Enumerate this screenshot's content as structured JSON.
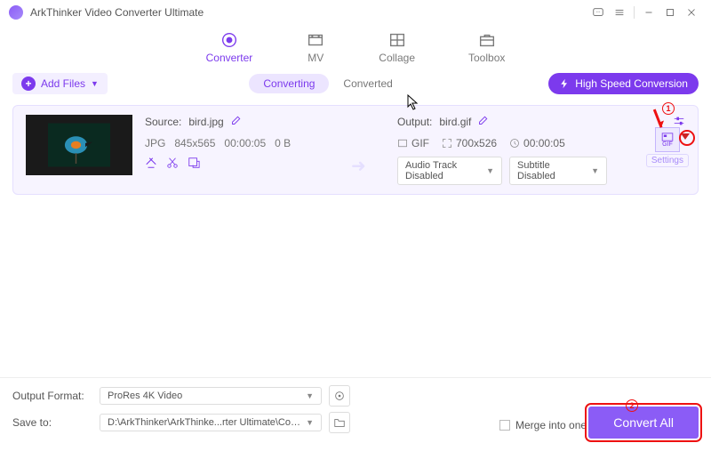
{
  "app": {
    "title": "ArkThinker Video Converter Ultimate"
  },
  "tabs": {
    "converter": "Converter",
    "mv": "MV",
    "collage": "Collage",
    "toolbox": "Toolbox"
  },
  "toolbar": {
    "add_files": "Add Files",
    "converting": "Converting",
    "converted": "Converted",
    "high_speed": "High Speed Conversion"
  },
  "file": {
    "source_label": "Source:",
    "source_name": "bird.jpg",
    "src_format": "JPG",
    "src_dims": "845x565",
    "src_dur": "00:00:05",
    "src_size": "0 B",
    "output_label": "Output:",
    "output_name": "bird.gif",
    "out_format": "GIF",
    "out_dims": "700x526",
    "out_dur": "00:00:05",
    "audio_track": "Audio Track Disabled",
    "subtitle": "Subtitle Disabled",
    "fmt_tile": "GIF",
    "settings": "Settings"
  },
  "bottom": {
    "output_format_lbl": "Output Format:",
    "output_format_val": "ProRes 4K Video",
    "save_to_lbl": "Save to:",
    "save_to_val": "D:\\ArkThinker\\ArkThinke...rter Ultimate\\Converted",
    "merge": "Merge into one file",
    "convert": "Convert All"
  },
  "annot": {
    "n1": "1",
    "n2": "2"
  }
}
